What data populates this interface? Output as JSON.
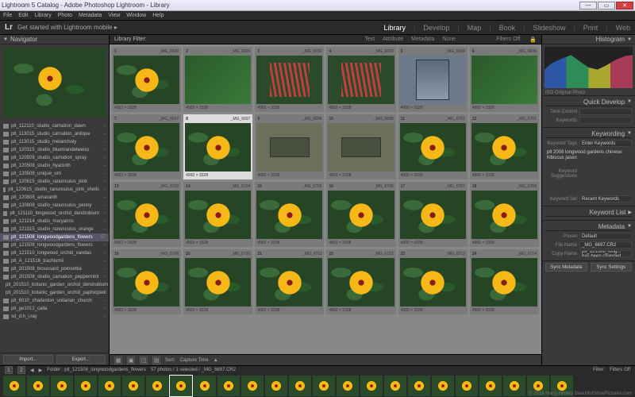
{
  "window": {
    "title": "Lightroom 5 Catalog - Adobe Photoshop Lightroom - Library"
  },
  "menubar": [
    "File",
    "Edit",
    "Library",
    "Photo",
    "Metadata",
    "View",
    "Window",
    "Help"
  ],
  "identity": {
    "logo": "Lr",
    "plate": "Get started with Lightroom mobile ▸"
  },
  "modules": [
    {
      "label": "Library",
      "active": true
    },
    {
      "label": "Develop",
      "active": false
    },
    {
      "label": "Map",
      "active": false
    },
    {
      "label": "Book",
      "active": false
    },
    {
      "label": "Slideshow",
      "active": false
    },
    {
      "label": "Print",
      "active": false
    },
    {
      "label": "Web",
      "active": false
    }
  ],
  "left": {
    "navigator": "Navigator",
    "folders": [
      {
        "name": "plt_112110_studio_carnation_dawn",
        "count": "-"
      },
      {
        "name": "plt_113015_studio_carnation_antique",
        "count": "-"
      },
      {
        "name": "plt_113015_studio_melancholy",
        "count": "-"
      },
      {
        "name": "plt_120315_studio_bluemandelweiss",
        "count": "-"
      },
      {
        "name": "plt_120508_studio_carnation_spray",
        "count": "-"
      },
      {
        "name": "plt_120508_studio_hyacinth",
        "count": "-"
      },
      {
        "name": "plt_120508_unique_urn",
        "count": "-"
      },
      {
        "name": "plt_120615_studio_ranunculus_pink",
        "count": "-"
      },
      {
        "name": "plt_120615_studio_ranunculus_pink_shells",
        "count": "-"
      },
      {
        "name": "plt_120808_amaranth",
        "count": "-"
      },
      {
        "name": "plt_120808_studio_ranunculus_penny",
        "count": "-"
      },
      {
        "name": "plt_121110_longwood_orchid_dendrobium",
        "count": "-"
      },
      {
        "name": "plt_121214_studio_maryanns",
        "count": "-"
      },
      {
        "name": "plt_121315_studio_ranunculus_orange",
        "count": "-"
      },
      {
        "name": "plt_121508_longwoodgardens_flowers",
        "count": "57",
        "sel": true
      },
      {
        "name": "plt_121508_longwoodgardens_flowers",
        "count": "-"
      },
      {
        "name": "plt_121510_longwood_orchid_vandas",
        "count": "-"
      },
      {
        "name": "plt_A_121516_trachiumii",
        "count": "-"
      },
      {
        "name": "plt_201508_broussard_poinsettia",
        "count": "-"
      },
      {
        "name": "plt_201508_studio_carnation_peppermint",
        "count": "-"
      },
      {
        "name": "plt_201510_botanic_garden_orchid_dendrobium",
        "count": "-"
      },
      {
        "name": "plt_201510_botanic_garden_orchid_paphiopedi",
        "count": "-"
      },
      {
        "name": "plt_6010_charleston_unitarian_church",
        "count": "-"
      },
      {
        "name": "plt_ge1012_calla",
        "count": "-"
      },
      {
        "name": "sd_d.h_i.ray",
        "count": "-"
      }
    ],
    "import": "Import...",
    "export": "Export..."
  },
  "filterbar": {
    "title": "Library Filter:",
    "tabs": [
      "Text",
      "Attribute",
      "Metadata",
      "None"
    ],
    "filtersoff": "Filters Off"
  },
  "grid": {
    "filename_prefix": "_MG_66",
    "dims": "4992 × 3328",
    "cells": [
      {
        "idx": 1,
        "fn": "_MG_6690",
        "variant": "yflower"
      },
      {
        "idx": 2,
        "fn": "_MG_6690",
        "variant": "green"
      },
      {
        "idx": 3,
        "fn": "_MG_6692",
        "variant": "red"
      },
      {
        "idx": 4,
        "fn": "_MG_6693",
        "variant": "red"
      },
      {
        "idx": 5,
        "fn": "_MG_6694",
        "variant": "window"
      },
      {
        "idx": 6,
        "fn": "_MG_6695",
        "variant": "green"
      },
      {
        "idx": 7,
        "fn": "_MG_6697",
        "variant": "yflower"
      },
      {
        "idx": 8,
        "fn": "_MG_6697",
        "variant": "yflower",
        "sel": true
      },
      {
        "idx": 9,
        "fn": "_MG_6698",
        "variant": "plaque"
      },
      {
        "idx": 10,
        "fn": "_MG_6699",
        "variant": "plaque"
      },
      {
        "idx": 11,
        "fn": "_MG_6701",
        "variant": "yflower"
      },
      {
        "idx": 12,
        "fn": "_MG_6701",
        "variant": "yflower"
      },
      {
        "idx": 13,
        "fn": "_MG_6703",
        "variant": "yflower"
      },
      {
        "idx": 14,
        "fn": "_MG_6704",
        "variant": "yflower"
      },
      {
        "idx": 15,
        "fn": "_MG_6705",
        "variant": "yflower"
      },
      {
        "idx": 16,
        "fn": "_MG_6706",
        "variant": "yflower"
      },
      {
        "idx": 17,
        "fn": "_MG_6707",
        "variant": "yflower"
      },
      {
        "idx": 18,
        "fn": "_MG_6708",
        "variant": "yflower"
      },
      {
        "idx": 19,
        "fn": "_MG_6709",
        "variant": "yflower"
      },
      {
        "idx": 20,
        "fn": "_MG_6710",
        "variant": "yflower"
      },
      {
        "idx": 21,
        "fn": "_MG_6711",
        "variant": "yflower"
      },
      {
        "idx": 22,
        "fn": "_MG_6712",
        "variant": "yflower"
      },
      {
        "idx": 23,
        "fn": "_MG_6713",
        "variant": "yflower"
      },
      {
        "idx": 24,
        "fn": "_MG_6714",
        "variant": "yflower"
      }
    ]
  },
  "toolbar": {
    "sort_label": "Sort:",
    "sort_value": "Capture Time",
    "status": "57 photos / 1 selected / _MG_6697.CR2",
    "folder_label": "Folder : plt_121508_longwoodgardens_flowers",
    "filter_label": "Filter:",
    "filters_off": "Filters Off"
  },
  "right": {
    "histogram": "Histogram",
    "iso_line": "ISO Original Photo",
    "quickdev": {
      "title": "Quick Develop",
      "treatment_label": "Tone Control",
      "treatment_value": "",
      "wb_label": "Keywords"
    },
    "keywording": {
      "title": "Keywording",
      "tags_label": "Keyword Tags",
      "enter_label": "Enter Keywords",
      "value": "plt 2008 longwood gardens chinese hibiscus jason",
      "suggest": "Keyword Suggestions",
      "set_label": "Keyword Set",
      "set_value": "Recent Keywords"
    },
    "keywordlist": "Keyword List",
    "metadata": {
      "title": "Metadata",
      "preset_label": "Preset",
      "preset_value": "Default",
      "filename_label": "File Name",
      "filename_value": "_MG_6697.CR2",
      "copyname_label": "Copy Name",
      "note": "plt_121508_long... has been changed"
    },
    "sync_meta": "Sync Metadata",
    "sync_settings": "Sync Settings"
  },
  "copyright": "© 2016 Harry Hilders BeautifulShoePictures.com"
}
